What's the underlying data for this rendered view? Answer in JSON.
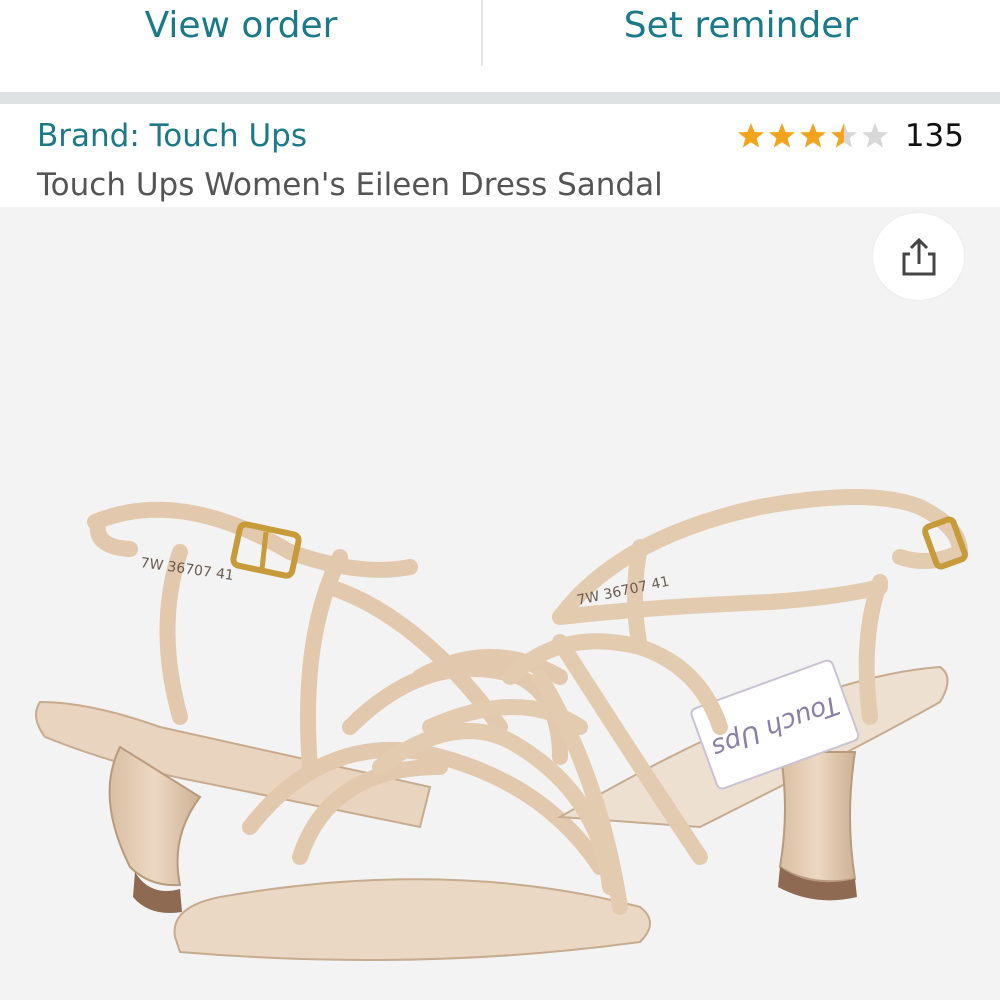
{
  "top_actions": {
    "view_order": "View order",
    "set_reminder": "Set reminder"
  },
  "product": {
    "brand": "Brand: Touch Ups",
    "title": "Touch Ups Women's Eileen Dress Sandal",
    "rating": {
      "stars": 3.5,
      "max": 5,
      "count": "135"
    }
  },
  "image": {
    "insole_label": "Touch Ups",
    "size_print_left": "7W 36707 41",
    "size_print_right": "7W 36707 41"
  },
  "icons": {
    "share": "share-icon"
  },
  "colors": {
    "link": "#1a7a8a",
    "star": "#f4a41c",
    "star_empty": "#d8d8d8",
    "background": "#f3f3f3",
    "sandal": "#e5cdb3"
  }
}
